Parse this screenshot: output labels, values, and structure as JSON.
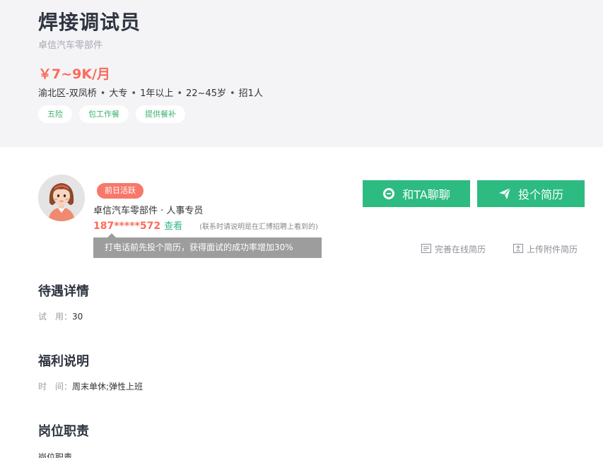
{
  "job": {
    "title": "焊接调试员",
    "company": "卓信汽车零部件",
    "salary": "￥7~9K/月",
    "meta": [
      "渝北区-双凤桥",
      "大专",
      "1年以上",
      "22~45岁",
      "招1人"
    ],
    "tags": [
      "五险",
      "包工作餐",
      "提供餐补"
    ]
  },
  "recruiter": {
    "active_badge": "前日活跃",
    "info": "卓信汽车零部件 · 人事专员",
    "phone": "187*****572",
    "view_label": "查看",
    "phone_note": "(联系时请说明是在汇博招聘上看到的)",
    "tooltip": "打电话前先投个简历，获得面试的成功率增加30%"
  },
  "actions": {
    "chat_label": "和TA聊聊",
    "resume_label": "投个简历",
    "online_resume_label": "完善在线简历",
    "upload_resume_label": "上传附件简历"
  },
  "sections": {
    "benefits": {
      "title": "待遇详情",
      "label": "试　用：",
      "value": "30"
    },
    "welfare": {
      "title": "福利说明",
      "label": "时　间：",
      "value": "周末单休;弹性上班"
    },
    "duties": {
      "title": "岗位职责",
      "partial": "岗位职责"
    }
  },
  "colors": {
    "accent": "#2dbb82",
    "salary": "#fb6b5b",
    "badge": "#f7786b"
  }
}
